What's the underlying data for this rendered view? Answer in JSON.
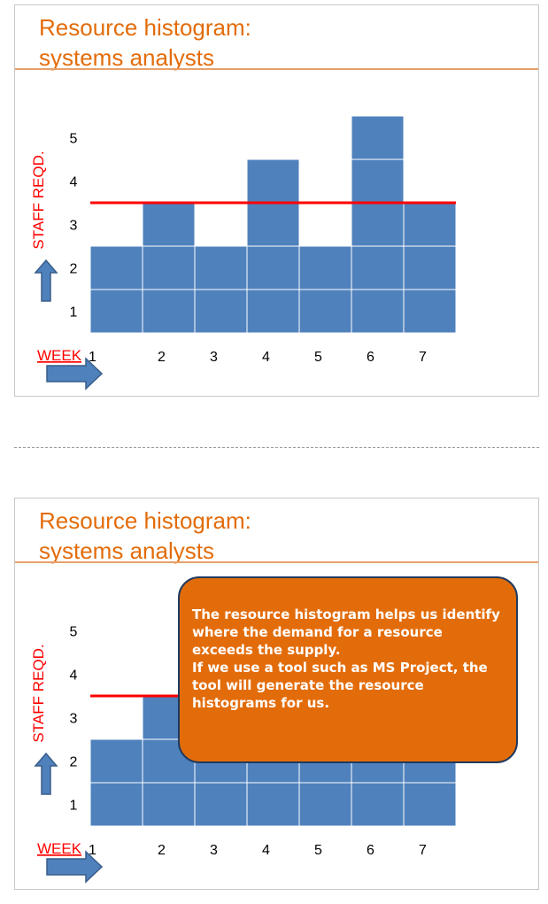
{
  "slides": [
    {
      "title_line1": "Resource histogram:",
      "title_line2": "systems analysts",
      "callout": null
    },
    {
      "title_line1": "Resource histogram:",
      "title_line2": "systems analysts",
      "callout": {
        "line1": "The resource histogram helps us identify where the demand for a resource exceeds the supply.",
        "line2": "If we use a tool such as MS Project, the tool will generate the resource histograms for us."
      }
    }
  ],
  "chart_data": {
    "type": "bar",
    "categories": [
      "1",
      "2",
      "3",
      "4",
      "5",
      "6",
      "7"
    ],
    "values": [
      2,
      3,
      2,
      4,
      2,
      5,
      3
    ],
    "ylabel": "STAFF REQD.",
    "xlabel": "WEEK",
    "yticks": [
      "1",
      "2",
      "3",
      "4",
      "5"
    ],
    "ylim": [
      0,
      5
    ],
    "supply_line": 3,
    "colors": {
      "bar": "#4f81bd",
      "bar_line": "#ffffff",
      "supply": "#ff0000",
      "axis_label": "#ff0000",
      "arrow": "#4f81bd"
    }
  }
}
